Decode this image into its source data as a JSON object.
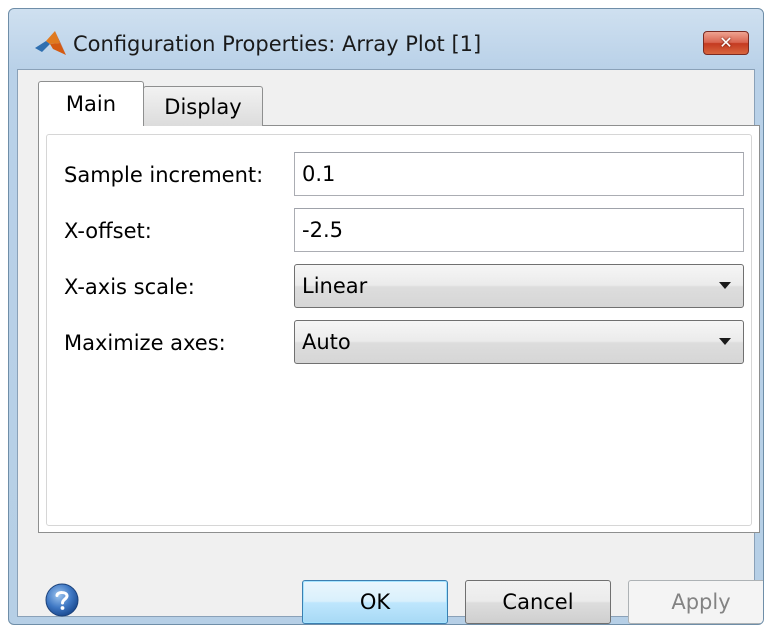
{
  "window": {
    "title": "Configuration Properties: Array Plot [1]",
    "close_glyph": "✕",
    "app_icon": "matlab-logo-icon"
  },
  "tabs": [
    {
      "label": "Main",
      "selected": true
    },
    {
      "label": "Display",
      "selected": false
    }
  ],
  "fields": {
    "sample_increment": {
      "label": "Sample increment:",
      "value": "0.1"
    },
    "x_offset": {
      "label": "X-offset:",
      "value": "-2.5"
    },
    "x_axis_scale": {
      "label": "X-axis scale:",
      "value": "Linear"
    },
    "maximize_axes": {
      "label": "Maximize axes:",
      "value": "Auto"
    }
  },
  "buttons": {
    "help_icon": "help-icon",
    "ok": "OK",
    "cancel": "Cancel",
    "apply": "Apply",
    "apply_enabled": false
  },
  "colors": {
    "titlebar": "#b9d1e8",
    "ok_border": "#3c7fb1",
    "close_button": "#c43a21"
  }
}
